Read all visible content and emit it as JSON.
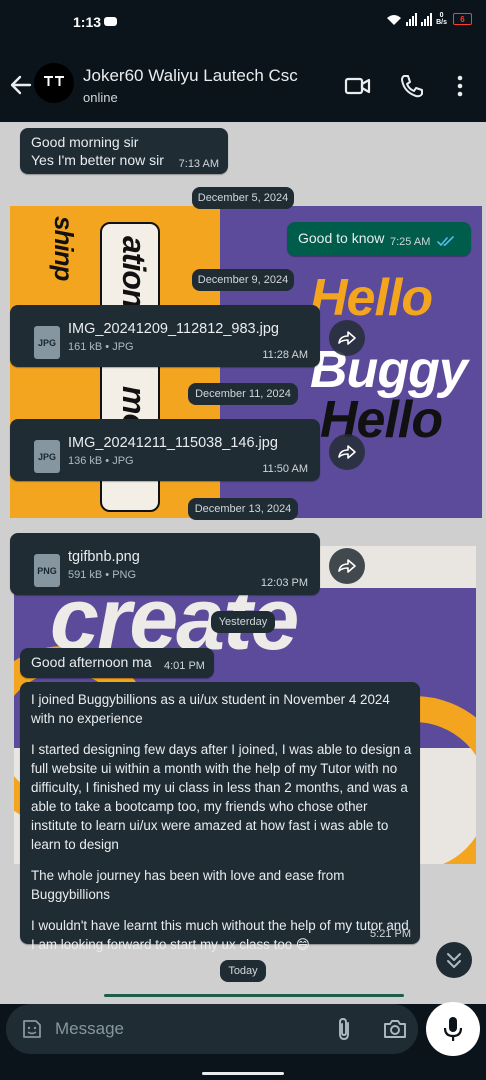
{
  "status_bar": {
    "time": "1:13",
    "net_speed_top": "0",
    "net_speed_unit": "B/s",
    "battery": "6"
  },
  "header": {
    "contact_name": "Joker60 Waliyu Lautech Csc",
    "status": "online"
  },
  "messages": [
    {
      "lines": [
        "Good morning sir",
        "Yes I'm better now sir"
      ],
      "time": "7:13 AM"
    },
    {
      "date": "December 5, 2024"
    },
    {
      "text": "Good to know",
      "time": "7:25 AM"
    },
    {
      "date": "December 9, 2024"
    },
    {
      "file_name": "IMG_20241209_112812_983.jpg",
      "file_type": "JPG",
      "meta": "161 kB • JPG",
      "time": "11:28 AM"
    },
    {
      "date": "December 11, 2024"
    },
    {
      "file_name": "IMG_20241211_115038_146.jpg",
      "file_type": "JPG",
      "meta": "136 kB • JPG",
      "time": "11:50 AM"
    },
    {
      "date": "December 13, 2024"
    },
    {
      "file_name": "tgifbnb.png",
      "file_type": "PNG",
      "meta": "591 kB • PNG",
      "time": "12:03 PM"
    },
    {
      "date": "Yesterday"
    },
    {
      "text": "Good afternoon ma",
      "time": "4:01 PM"
    },
    {
      "paragraphs": [
        "I joined Buggybillions as a ui/ux student in November 4 2024 with no experience",
        "I started designing few days after I joined, I was able to  design a full website ui within a month with the help of my Tutor with no difficulty, I finished my ui class in less than 2 months, and was a able to take a bootcamp too, my friends who chose other institute to learn ui/ux were amazed at how fast i was able to learn to design",
        "The whole journey has been with love and ease from Buggybillions",
        "I wouldn't have learnt this much without the help of my tutor and I am  looking forward to start my ux class too 😄"
      ],
      "time": "5:21 PM"
    },
    {
      "date": "Today"
    }
  ],
  "wallpaper_words": [
    "Hello",
    "Buggy",
    "Hello",
    "ation",
    "mo",
    "shinp",
    "create"
  ],
  "composer": {
    "placeholder": "Message"
  },
  "colors": {
    "incoming_bubble": "#1f2c34",
    "outgoing_bubble": "#005c4b",
    "background": "#0b141a",
    "read_ticks": "#53bdeb"
  }
}
